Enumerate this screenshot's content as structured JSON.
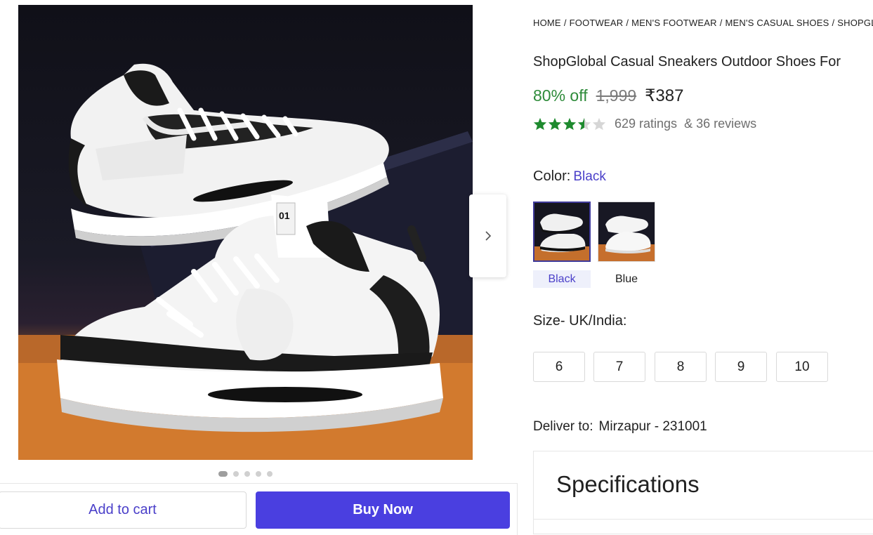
{
  "breadcrumb": [
    "HOME",
    "FOOTWEAR",
    "MEN'S FOOTWEAR",
    "MEN'S CASUAL SHOES",
    "SHOPGL"
  ],
  "product": {
    "title": "ShopGlobal Casual Sneakers Outdoor Shoes For",
    "discount": "80% off",
    "mrp": "1,999",
    "price": "₹387",
    "rating_value": 3.5,
    "ratings_text": "629 ratings",
    "reviews_text": "& 36 reviews"
  },
  "color": {
    "label": "Color:",
    "selected": "Black",
    "options": [
      {
        "label": "Black"
      },
      {
        "label": "Blue"
      }
    ]
  },
  "size": {
    "label": "Size- UK/India:",
    "options": [
      "6",
      "7",
      "8",
      "9",
      "10"
    ]
  },
  "delivery": {
    "label": "Deliver to:",
    "location": "Mirzapur - 231001"
  },
  "specifications": {
    "title": "Specifications"
  },
  "gallery": {
    "total_images": 5,
    "active_index": 0
  },
  "actions": {
    "add_to_cart": "Add to cart",
    "buy_now": "Buy Now"
  },
  "colors": {
    "accent": "#4a3fe0",
    "discount_green": "#2e8b3a",
    "star_green": "#1e8a2e"
  },
  "icons": {
    "next": "chevron-right-icon",
    "star": "star-icon"
  }
}
